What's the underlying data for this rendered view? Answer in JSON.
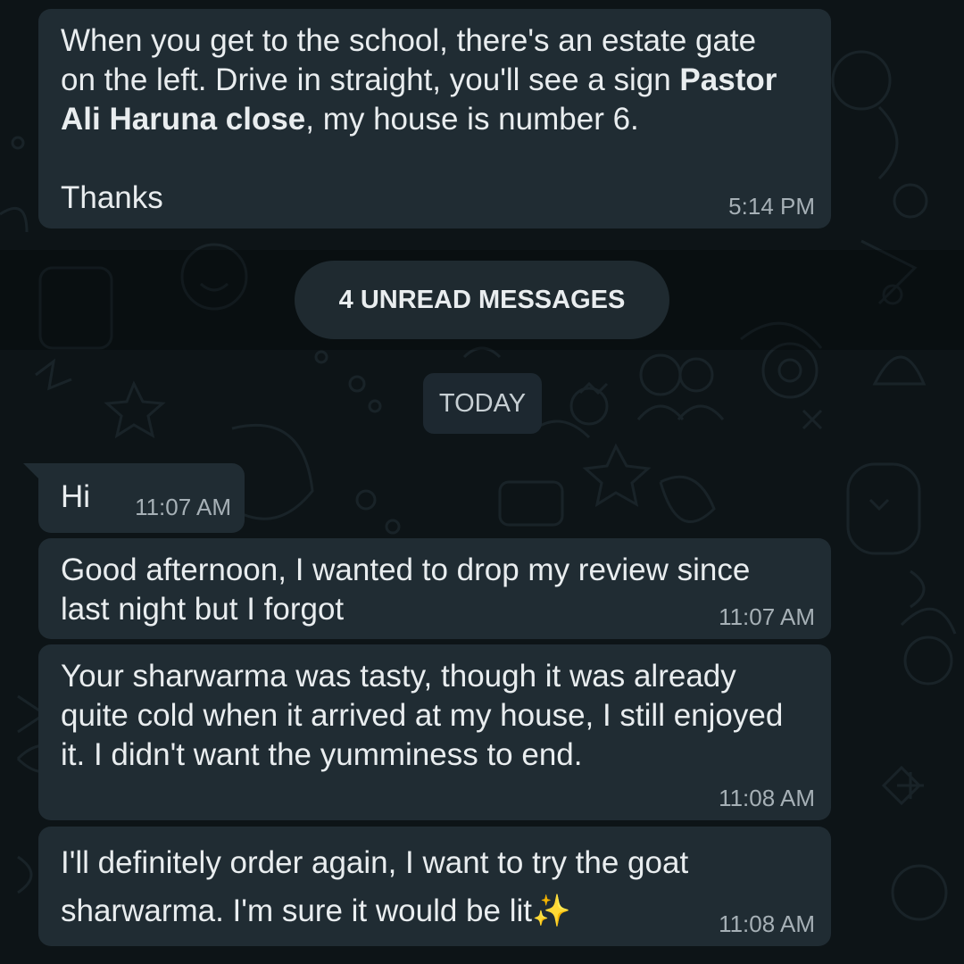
{
  "messages": {
    "m1": {
      "line1": "When you get to the school, there's an estate gate",
      "line2_prefix": "on the left. Drive in straight, you'll see a sign ",
      "line2_bold": "Pastor",
      "line3_bold": "Ali Haruna close",
      "line3_suffix": ", my house is number 6.",
      "line4": "Thanks",
      "time": "5:14 PM"
    },
    "m2": {
      "text": "Hi",
      "time": "11:07 AM"
    },
    "m3": {
      "text": "Good afternoon, I wanted to drop my review since last night but I forgot",
      "time": "11:07 AM"
    },
    "m4": {
      "text": "Your sharwarma was tasty, though it was already quite cold when it arrived at my house, I still enjoyed it. I didn't want the yumminess to end.",
      "time": "11:08 AM"
    },
    "m5": {
      "text": "I'll definitely order again, I want to try the goat sharwarma. I'm sure it would be lit✨",
      "time": "11:08 AM"
    }
  },
  "separators": {
    "unread": "4 UNREAD MESSAGES",
    "date": "TODAY"
  }
}
